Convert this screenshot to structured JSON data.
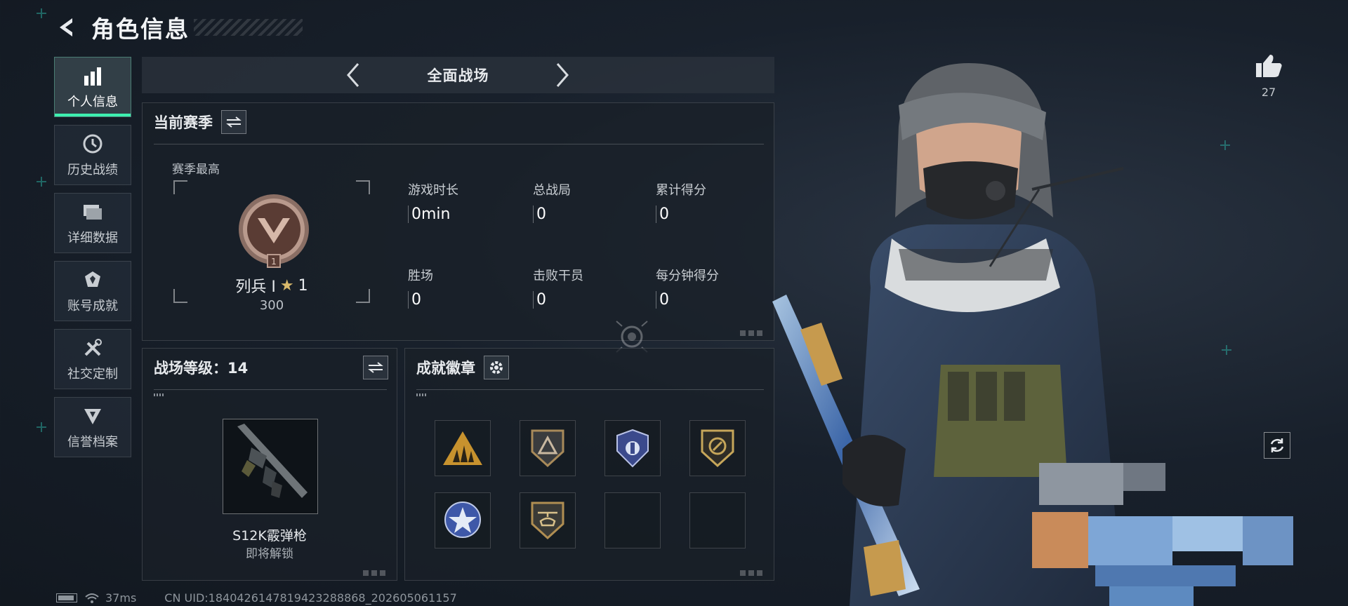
{
  "header": {
    "title": "角色信息"
  },
  "sidebar": {
    "items": [
      {
        "label": "个人信息",
        "icon": "bar-chart-icon",
        "active": true
      },
      {
        "label": "历史战绩",
        "icon": "history-clock-icon",
        "active": false
      },
      {
        "label": "详细数据",
        "icon": "folder-icon",
        "active": false
      },
      {
        "label": "账号成就",
        "icon": "achievement-icon",
        "active": false
      },
      {
        "label": "社交定制",
        "icon": "tools-icon",
        "active": false
      },
      {
        "label": "信誉档案",
        "icon": "reputation-icon",
        "active": false
      }
    ]
  },
  "mode": {
    "title": "全面战场"
  },
  "season": {
    "title": "当前赛季",
    "best_label": "赛季最高",
    "rank_name": "列兵 Ⅰ",
    "rank_stars": "1",
    "rank_score": "300",
    "stats": [
      {
        "label": "游戏时长",
        "value": "0min"
      },
      {
        "label": "总战局",
        "value": "0"
      },
      {
        "label": "累计得分",
        "value": "0"
      },
      {
        "label": "胜场",
        "value": "0"
      },
      {
        "label": "击败干员",
        "value": "0"
      },
      {
        "label": "每分钟得分",
        "value": "0"
      }
    ]
  },
  "level": {
    "title": "战场等级：14",
    "weapon_name": "S12K霰弹枪",
    "weapon_status": "即将解锁"
  },
  "badges": {
    "title": "成就徽章",
    "items": [
      "soldiers-badge-icon",
      "triangle-shield-badge-icon",
      "police-badge-icon",
      "medic-badge-icon",
      "star-emblem-badge-icon",
      "helicopter-badge-icon",
      "",
      ""
    ]
  },
  "like": {
    "count": "27"
  },
  "footer": {
    "ping": "37ms",
    "uid": "CN UID:1840426147819423288868_202605061157"
  },
  "colors": {
    "accent": "#3df0b0",
    "panel": "#1a2028",
    "text": "#e6e9ec"
  }
}
